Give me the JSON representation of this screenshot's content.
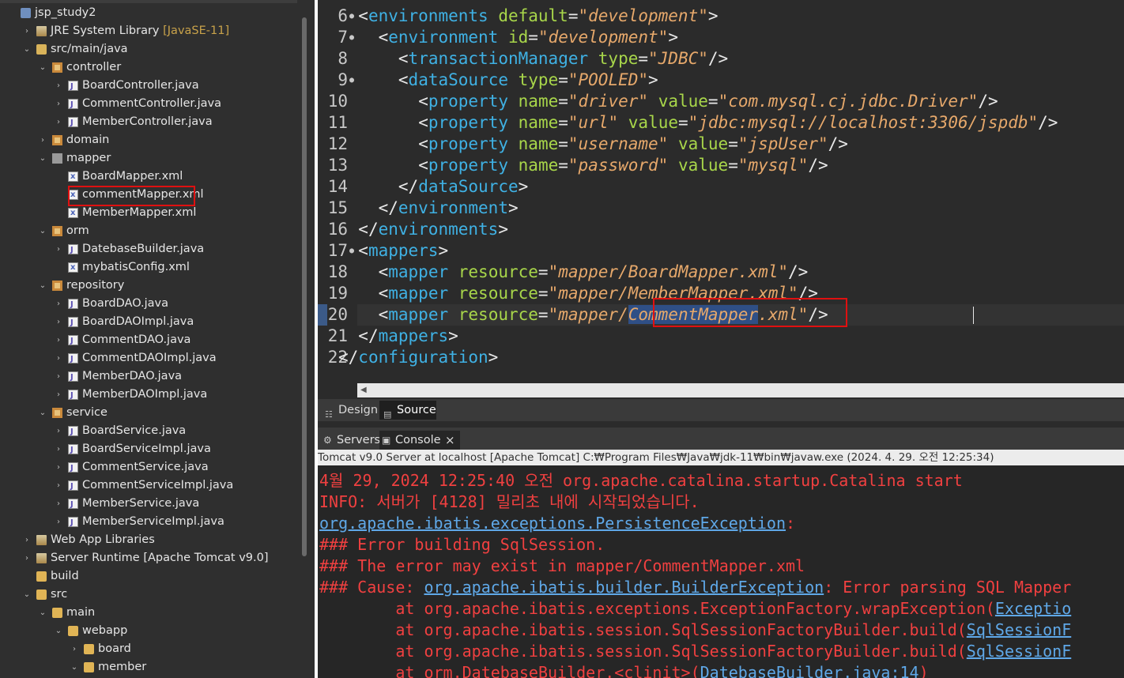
{
  "explorer": {
    "items": [
      {
        "label": "jsp_study2",
        "indent": 0,
        "arrow": "",
        "icon": "project-icon",
        "cls": "ic-project"
      },
      {
        "label": "JRE System Library",
        "suffix": " [JavaSE-11]",
        "indent": 1,
        "arrow": "›",
        "icon": "library-icon",
        "cls": "ic-lib"
      },
      {
        "label": "src/main/java",
        "indent": 1,
        "arrow": "⌄",
        "icon": "source-folder-icon",
        "cls": "ic-srcfolder"
      },
      {
        "label": "controller",
        "indent": 2,
        "arrow": "⌄",
        "icon": "package-icon",
        "cls": "ic-package"
      },
      {
        "label": "BoardController.java",
        "indent": 3,
        "arrow": "›",
        "icon": "java-file-icon",
        "cls": "ic-java"
      },
      {
        "label": "CommentController.java",
        "indent": 3,
        "arrow": "›",
        "icon": "java-file-icon",
        "cls": "ic-java"
      },
      {
        "label": "MemberController.java",
        "indent": 3,
        "arrow": "›",
        "icon": "java-file-icon",
        "cls": "ic-java"
      },
      {
        "label": "domain",
        "indent": 2,
        "arrow": "›",
        "icon": "package-icon",
        "cls": "ic-package"
      },
      {
        "label": "mapper",
        "indent": 2,
        "arrow": "⌄",
        "icon": "package-icon",
        "cls": "ic-emptypkg"
      },
      {
        "label": "BoardMapper.xml",
        "indent": 3,
        "arrow": "",
        "icon": "xml-file-icon",
        "cls": "ic-xml"
      },
      {
        "label": "commentMapper.xml",
        "indent": 3,
        "arrow": "",
        "icon": "xml-file-icon",
        "cls": "ic-xml",
        "highlight": true
      },
      {
        "label": "MemberMapper.xml",
        "indent": 3,
        "arrow": "",
        "icon": "xml-file-icon",
        "cls": "ic-xml"
      },
      {
        "label": "orm",
        "indent": 2,
        "arrow": "⌄",
        "icon": "package-icon",
        "cls": "ic-package"
      },
      {
        "label": "DatebaseBuilder.java",
        "indent": 3,
        "arrow": "›",
        "icon": "java-file-icon",
        "cls": "ic-java"
      },
      {
        "label": "mybatisConfig.xml",
        "indent": 3,
        "arrow": "",
        "icon": "xml-file-icon",
        "cls": "ic-xml"
      },
      {
        "label": "repository",
        "indent": 2,
        "arrow": "⌄",
        "icon": "package-icon",
        "cls": "ic-package"
      },
      {
        "label": "BoardDAO.java",
        "indent": 3,
        "arrow": "›",
        "icon": "java-file-icon",
        "cls": "ic-java"
      },
      {
        "label": "BoardDAOImpl.java",
        "indent": 3,
        "arrow": "›",
        "icon": "java-file-icon",
        "cls": "ic-java"
      },
      {
        "label": "CommentDAO.java",
        "indent": 3,
        "arrow": "›",
        "icon": "java-file-icon",
        "cls": "ic-java"
      },
      {
        "label": "CommentDAOImpl.java",
        "indent": 3,
        "arrow": "›",
        "icon": "java-file-icon",
        "cls": "ic-java"
      },
      {
        "label": "MemberDAO.java",
        "indent": 3,
        "arrow": "›",
        "icon": "java-file-icon",
        "cls": "ic-java"
      },
      {
        "label": "MemberDAOImpl.java",
        "indent": 3,
        "arrow": "›",
        "icon": "java-file-icon",
        "cls": "ic-java"
      },
      {
        "label": "service",
        "indent": 2,
        "arrow": "⌄",
        "icon": "package-icon",
        "cls": "ic-package"
      },
      {
        "label": "BoardService.java",
        "indent": 3,
        "arrow": "›",
        "icon": "java-file-icon",
        "cls": "ic-java"
      },
      {
        "label": "BoardServiceImpl.java",
        "indent": 3,
        "arrow": "›",
        "icon": "java-file-icon",
        "cls": "ic-java"
      },
      {
        "label": "CommentService.java",
        "indent": 3,
        "arrow": "›",
        "icon": "java-file-icon",
        "cls": "ic-java"
      },
      {
        "label": "CommentServiceImpl.java",
        "indent": 3,
        "arrow": "›",
        "icon": "java-file-icon",
        "cls": "ic-java"
      },
      {
        "label": "MemberService.java",
        "indent": 3,
        "arrow": "›",
        "icon": "java-file-icon",
        "cls": "ic-java"
      },
      {
        "label": "MemberServiceImpl.java",
        "indent": 3,
        "arrow": "›",
        "icon": "java-file-icon",
        "cls": "ic-java"
      },
      {
        "label": "Web App Libraries",
        "indent": 1,
        "arrow": "›",
        "icon": "library-icon",
        "cls": "ic-lib"
      },
      {
        "label": "Server Runtime [Apache Tomcat v9.0]",
        "indent": 1,
        "arrow": "›",
        "icon": "library-icon",
        "cls": "ic-lib"
      },
      {
        "label": "build",
        "indent": 1,
        "arrow": "",
        "icon": "folder-icon",
        "cls": "ic-folder"
      },
      {
        "label": "src",
        "indent": 1,
        "arrow": "⌄",
        "icon": "folder-icon",
        "cls": "ic-folder"
      },
      {
        "label": "main",
        "indent": 2,
        "arrow": "⌄",
        "icon": "folder-icon",
        "cls": "ic-folder"
      },
      {
        "label": "webapp",
        "indent": 3,
        "arrow": "⌄",
        "icon": "folder-icon",
        "cls": "ic-folder"
      },
      {
        "label": "board",
        "indent": 4,
        "arrow": "›",
        "icon": "folder-icon",
        "cls": "ic-folder"
      },
      {
        "label": "member",
        "indent": 4,
        "arrow": "⌄",
        "icon": "folder-icon",
        "cls": "ic-folder"
      }
    ]
  },
  "editor": {
    "lines": [
      {
        "n": "6",
        "fold": true,
        "indent": 1,
        "toks": [
          [
            "br",
            "<"
          ],
          [
            "tag",
            "environments"
          ],
          [
            "br",
            " "
          ],
          [
            "attr",
            "default"
          ],
          [
            "br",
            "="
          ],
          [
            "val",
            "\"development\""
          ],
          [
            "br",
            ">"
          ]
        ]
      },
      {
        "n": "7",
        "fold": true,
        "indent": 2,
        "toks": [
          [
            "br",
            "<"
          ],
          [
            "tag",
            "environment"
          ],
          [
            "br",
            " "
          ],
          [
            "attr",
            "id"
          ],
          [
            "br",
            "="
          ],
          [
            "val",
            "\"development\""
          ],
          [
            "br",
            ">"
          ]
        ]
      },
      {
        "n": "8",
        "fold": false,
        "indent": 3,
        "toks": [
          [
            "br",
            "<"
          ],
          [
            "tag",
            "transactionManager"
          ],
          [
            "br",
            " "
          ],
          [
            "attr",
            "type"
          ],
          [
            "br",
            "="
          ],
          [
            "val",
            "\"JDBC\""
          ],
          [
            "br",
            "/>"
          ]
        ]
      },
      {
        "n": "9",
        "fold": true,
        "indent": 3,
        "toks": [
          [
            "br",
            "<"
          ],
          [
            "tag",
            "dataSource"
          ],
          [
            "br",
            " "
          ],
          [
            "attr",
            "type"
          ],
          [
            "br",
            "="
          ],
          [
            "val",
            "\"POOLED\""
          ],
          [
            "br",
            ">"
          ]
        ]
      },
      {
        "n": "10",
        "fold": false,
        "indent": 4,
        "toks": [
          [
            "br",
            "<"
          ],
          [
            "tag",
            "property"
          ],
          [
            "br",
            " "
          ],
          [
            "attr",
            "name"
          ],
          [
            "br",
            "="
          ],
          [
            "val",
            "\"driver\""
          ],
          [
            "br",
            " "
          ],
          [
            "attr",
            "value"
          ],
          [
            "br",
            "="
          ],
          [
            "val",
            "\"com.mysql.cj.jdbc.Driver\""
          ],
          [
            "br",
            "/>"
          ]
        ]
      },
      {
        "n": "11",
        "fold": false,
        "indent": 4,
        "toks": [
          [
            "br",
            "<"
          ],
          [
            "tag",
            "property"
          ],
          [
            "br",
            " "
          ],
          [
            "attr",
            "name"
          ],
          [
            "br",
            "="
          ],
          [
            "val",
            "\"url\""
          ],
          [
            "br",
            " "
          ],
          [
            "attr",
            "value"
          ],
          [
            "br",
            "="
          ],
          [
            "val",
            "\"jdbc:mysql://localhost:3306/jspdb\""
          ],
          [
            "br",
            "/>"
          ]
        ]
      },
      {
        "n": "12",
        "fold": false,
        "indent": 4,
        "toks": [
          [
            "br",
            "<"
          ],
          [
            "tag",
            "property"
          ],
          [
            "br",
            " "
          ],
          [
            "attr",
            "name"
          ],
          [
            "br",
            "="
          ],
          [
            "val",
            "\"username\""
          ],
          [
            "br",
            " "
          ],
          [
            "attr",
            "value"
          ],
          [
            "br",
            "="
          ],
          [
            "val",
            "\"jspUser\""
          ],
          [
            "br",
            "/>"
          ]
        ]
      },
      {
        "n": "13",
        "fold": false,
        "indent": 4,
        "toks": [
          [
            "br",
            "<"
          ],
          [
            "tag",
            "property"
          ],
          [
            "br",
            " "
          ],
          [
            "attr",
            "name"
          ],
          [
            "br",
            "="
          ],
          [
            "val",
            "\"password\""
          ],
          [
            "br",
            " "
          ],
          [
            "attr",
            "value"
          ],
          [
            "br",
            "="
          ],
          [
            "val",
            "\"mysql\""
          ],
          [
            "br",
            "/>"
          ]
        ]
      },
      {
        "n": "14",
        "fold": false,
        "indent": 3,
        "toks": [
          [
            "br",
            "</"
          ],
          [
            "tag",
            "dataSource"
          ],
          [
            "br",
            ">"
          ]
        ]
      },
      {
        "n": "15",
        "fold": false,
        "indent": 2,
        "toks": [
          [
            "br",
            "</"
          ],
          [
            "tag",
            "environment"
          ],
          [
            "br",
            ">"
          ]
        ]
      },
      {
        "n": "16",
        "fold": false,
        "indent": 1,
        "toks": [
          [
            "br",
            "</"
          ],
          [
            "tag",
            "environments"
          ],
          [
            "br",
            ">"
          ]
        ]
      },
      {
        "n": "17",
        "fold": true,
        "indent": 1,
        "toks": [
          [
            "br",
            "<"
          ],
          [
            "tag",
            "mappers"
          ],
          [
            "br",
            ">"
          ]
        ]
      },
      {
        "n": "18",
        "fold": false,
        "indent": 2,
        "toks": [
          [
            "br",
            "<"
          ],
          [
            "tag",
            "mapper"
          ],
          [
            "br",
            " "
          ],
          [
            "attr",
            "resource"
          ],
          [
            "br",
            "="
          ],
          [
            "val",
            "\"mapper/BoardMapper.xml\""
          ],
          [
            "br",
            "/>"
          ]
        ]
      },
      {
        "n": "19",
        "fold": false,
        "indent": 2,
        "toks": [
          [
            "br",
            "<"
          ],
          [
            "tag",
            "mapper"
          ],
          [
            "br",
            " "
          ],
          [
            "attr",
            "resource"
          ],
          [
            "br",
            "="
          ],
          [
            "val",
            "\"mapper/MemberMapper.xml\""
          ],
          [
            "br",
            "/>"
          ]
        ]
      },
      {
        "n": "20",
        "fold": false,
        "indent": 2,
        "toks": [
          [
            "br",
            "<"
          ],
          [
            "tag",
            "mapper"
          ],
          [
            "br",
            " "
          ],
          [
            "attr",
            "resource"
          ],
          [
            "br",
            "="
          ],
          [
            "val",
            "\"mapper/"
          ],
          [
            "valsel",
            "CommentMapper"
          ],
          [
            "val",
            ".xml\""
          ],
          [
            "br",
            "/>"
          ]
        ]
      },
      {
        "n": "21",
        "fold": false,
        "indent": 1,
        "toks": [
          [
            "br",
            "</"
          ],
          [
            "tag",
            "mappers"
          ],
          [
            "br",
            ">"
          ]
        ]
      },
      {
        "n": "22",
        "fold": false,
        "indent": 0,
        "toks": [
          [
            "br",
            "</"
          ],
          [
            "tag",
            "configuration"
          ],
          [
            "br",
            ">"
          ]
        ]
      }
    ]
  },
  "mode_tabs": {
    "design": "Design",
    "source": "Source"
  },
  "console_tabs": {
    "servers": "Servers",
    "console": "Console"
  },
  "console": {
    "header": "Tomcat v9.0 Server at localhost [Apache Tomcat] C:₩Program Files₩Java₩jdk-11₩bin₩javaw.exe  (2024. 4. 29. 오전 12:25:34)",
    "lines": [
      [
        [
          "t",
          "4월 29, 2024 12:25:40 오전 org.apache.catalina.startup.Catalina start"
        ]
      ],
      [
        [
          "t",
          "INFO: 서버가 [4128] 밀리초 내에 시작되었습니다."
        ]
      ],
      [
        [
          "l",
          "org.apache.ibatis.exceptions.PersistenceException"
        ],
        [
          "t",
          ":"
        ]
      ],
      [
        [
          "t",
          "### Error building SqlSession."
        ]
      ],
      [
        [
          "t",
          "### The error may exist in mapper/CommentMapper.xml"
        ]
      ],
      [
        [
          "t",
          "### Cause: "
        ],
        [
          "l",
          "org.apache.ibatis.builder.BuilderException"
        ],
        [
          "t",
          ": Error parsing SQL Mapper"
        ]
      ],
      [
        [
          "t",
          "\tat org.apache.ibatis.exceptions.ExceptionFactory.wrapException("
        ],
        [
          "l",
          "Exceptio"
        ]
      ],
      [
        [
          "t",
          "\tat org.apache.ibatis.session.SqlSessionFactoryBuilder.build("
        ],
        [
          "l",
          "SqlSessionF"
        ]
      ],
      [
        [
          "t",
          "\tat org.apache.ibatis.session.SqlSessionFactoryBuilder.build("
        ],
        [
          "l",
          "SqlSessionF"
        ]
      ],
      [
        [
          "t",
          "\tat orm.DatebaseBuilder.<clinit>("
        ],
        [
          "l",
          "DatebaseBuilder.java:14"
        ],
        [
          "t",
          ")"
        ]
      ]
    ]
  }
}
